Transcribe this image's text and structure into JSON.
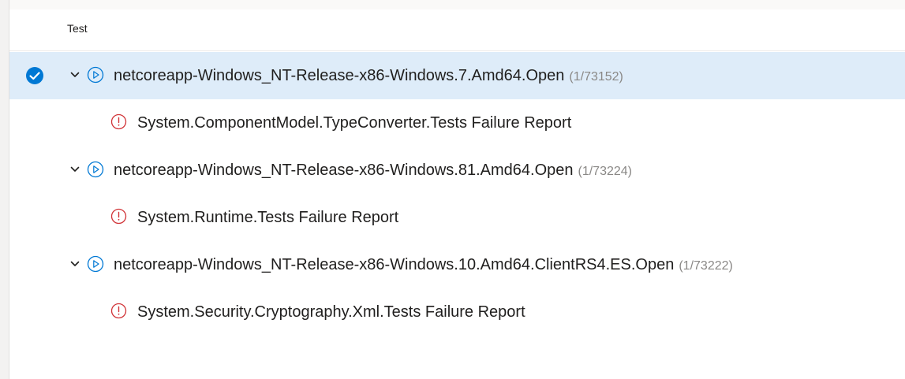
{
  "header": {
    "column_label": "Test"
  },
  "rows": [
    {
      "type": "group",
      "selected": true,
      "title": "netcoreapp-Windows_NT-Release-x86-Windows.7.Amd64.Open",
      "count": "(1/73152)",
      "icon": "play-circle-icon"
    },
    {
      "type": "child",
      "title": "System.ComponentModel.TypeConverter.Tests Failure Report",
      "icon": "error-circle-icon"
    },
    {
      "type": "group",
      "selected": false,
      "title": "netcoreapp-Windows_NT-Release-x86-Windows.81.Amd64.Open",
      "count": "(1/73224)",
      "icon": "play-circle-icon"
    },
    {
      "type": "child",
      "title": "System.Runtime.Tests Failure Report",
      "icon": "error-circle-icon"
    },
    {
      "type": "group",
      "selected": false,
      "title": "netcoreapp-Windows_NT-Release-x86-Windows.10.Amd64.ClientRS4.ES.Open",
      "count": "(1/73222)",
      "icon": "play-circle-icon"
    },
    {
      "type": "child",
      "title": "System.Security.Cryptography.Xml.Tests Failure Report",
      "icon": "error-circle-icon"
    }
  ],
  "colors": {
    "selection_bg": "#deecf9",
    "accent": "#0078d4",
    "error": "#d13438",
    "count_text": "#8a8886"
  }
}
